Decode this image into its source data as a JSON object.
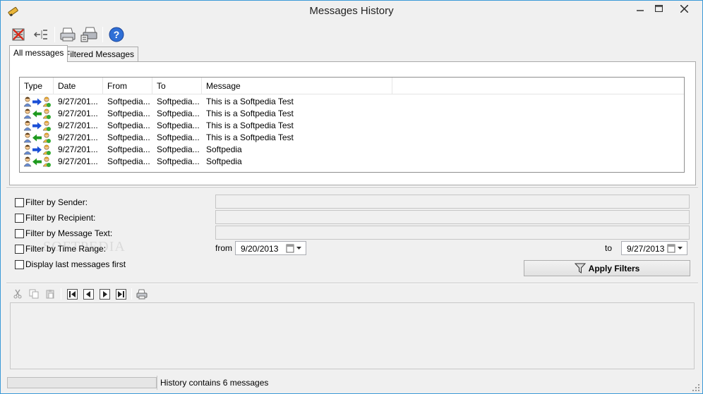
{
  "window": {
    "title": "Messages History"
  },
  "tabs": [
    {
      "label": "All messages",
      "active": true
    },
    {
      "label": "Filtered Messages",
      "active": false
    }
  ],
  "table": {
    "columns": [
      "Type",
      "Date",
      "From",
      "To",
      "Message"
    ],
    "rows": [
      {
        "direction": "outgoing",
        "date": "9/27/201...",
        "from": "Softpedia...",
        "to": "Softpedia...",
        "message": "This is a Softpedia Test"
      },
      {
        "direction": "incoming",
        "date": "9/27/201...",
        "from": "Softpedia...",
        "to": "Softpedia...",
        "message": "This is a Softpedia Test"
      },
      {
        "direction": "outgoing",
        "date": "9/27/201...",
        "from": "Softpedia...",
        "to": "Softpedia...",
        "message": "This is a Softpedia Test"
      },
      {
        "direction": "incoming",
        "date": "9/27/201...",
        "from": "Softpedia...",
        "to": "Softpedia...",
        "message": "This is a Softpedia Test"
      },
      {
        "direction": "outgoing",
        "date": "9/27/201...",
        "from": "Softpedia...",
        "to": "Softpedia...",
        "message": "Softpedia"
      },
      {
        "direction": "incoming",
        "date": "9/27/201...",
        "from": "Softpedia...",
        "to": "Softpedia...",
        "message": "Softpedia"
      }
    ]
  },
  "filters": {
    "by_sender": "Filter by Sender:",
    "by_recipient": "Filter by Recipient:",
    "by_text": "Filter by Message Text:",
    "by_time": "Filter by Time Range:",
    "last_first": "Display last messages first",
    "from_label": "from",
    "to_label": "to",
    "from_date": "9/20/2013",
    "to_date": "9/27/2013",
    "apply_label": "Apply Filters"
  },
  "status": {
    "text": "History contains 6 messages"
  },
  "watermark": "SOFTPEDIA",
  "colors": {
    "accent_border": "#3c9ad8",
    "arrow_blue": "#1a4fd6",
    "arrow_green": "#1e9a1e"
  }
}
